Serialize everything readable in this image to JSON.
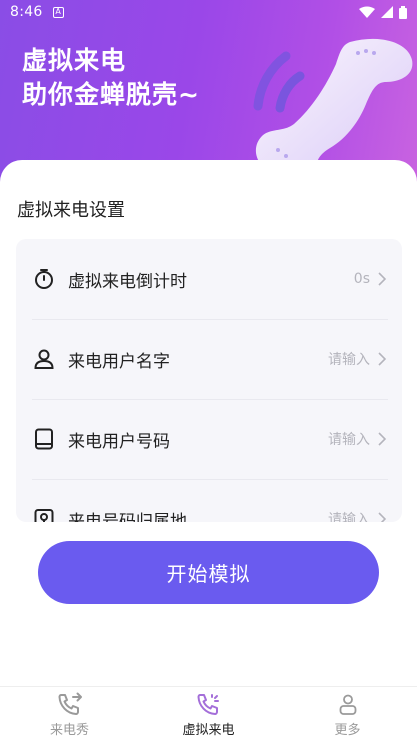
{
  "status_bar": {
    "time": "8:46",
    "notification_badge": "A"
  },
  "hero": {
    "line1": "虚拟来电",
    "line2": "助你金蝉脱壳~"
  },
  "settings": {
    "title": "虚拟来电设置",
    "rows": [
      {
        "icon": "timer-icon",
        "label": "虚拟来电倒计时",
        "value": "0s"
      },
      {
        "icon": "user-icon",
        "label": "来电用户名字",
        "value": "请输入"
      },
      {
        "icon": "phone-device-icon",
        "label": "来电用户号码",
        "value": "请输入"
      },
      {
        "icon": "location-icon",
        "label": "来电号码归属地",
        "value": "请输入"
      }
    ]
  },
  "start_button": {
    "label": "开始模拟"
  },
  "tabbar": {
    "tabs": [
      {
        "icon": "phone-call-icon",
        "label": "来电秀",
        "active": false
      },
      {
        "icon": "phone-sparkle-icon",
        "label": "虚拟来电",
        "active": true
      },
      {
        "icon": "more-person-icon",
        "label": "更多",
        "active": false
      }
    ]
  },
  "colors": {
    "accent": "#6a5bef",
    "hero_gradient_start": "#8a4de6",
    "hero_gradient_end": "#c963e0",
    "active_tab_icon": "#a46fd9"
  }
}
